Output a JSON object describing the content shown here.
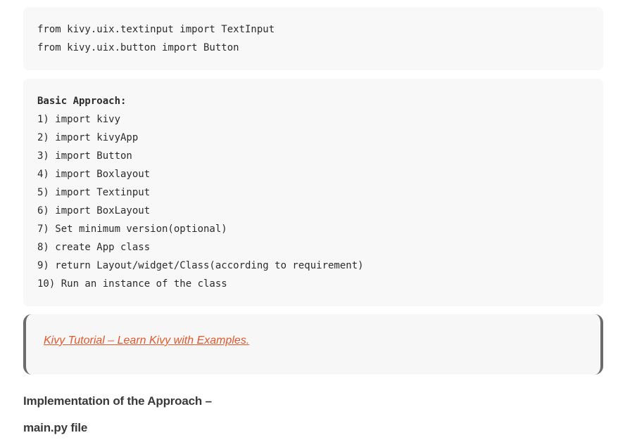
{
  "imports_block": {
    "lines": [
      "from kivy.uix.textinput import TextInput",
      "from kivy.uix.button import Button"
    ]
  },
  "approach_block": {
    "title": "Basic Approach:",
    "steps": [
      "1) import kivy",
      "2) import kivyApp",
      "3) import Button",
      "4) import Boxlayout",
      "5) import Textinput",
      "6) import BoxLayout",
      "7) Set minimum version(optional)",
      "8) create App class",
      "9) return Layout/widget/Class(according to requirement)",
      "10) Run an instance of the class"
    ]
  },
  "related_link": {
    "text": "Kivy Tutorial – Learn Kivy with Examples."
  },
  "section": {
    "implementation_heading": "Implementation of the Approach –",
    "file_heading": "main.py file"
  },
  "colors": {
    "link": "#e2582c",
    "code_bg": "#f8f8f8",
    "quote_border": "#6b6b6b",
    "heading_text": "#3a3a3a"
  }
}
